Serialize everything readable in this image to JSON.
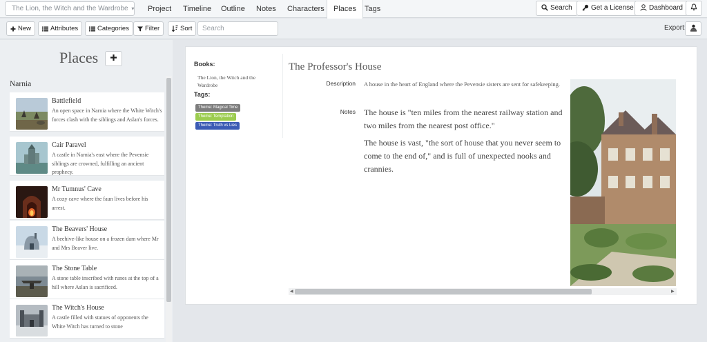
{
  "header": {
    "book_selector": "The Lion, the Witch and the Wardrobe",
    "nav": [
      "Project",
      "Timeline",
      "Outline",
      "Notes",
      "Characters",
      "Places",
      "Tags"
    ],
    "active_nav": "Places",
    "search_label": "Search",
    "license_label": "Get a License",
    "dashboard_label": "Dashboard"
  },
  "toolbar": {
    "new_label": "New",
    "attributes_label": "Attributes",
    "categories_label": "Categories",
    "filter_label": "Filter",
    "sort_label": "Sort",
    "search_placeholder": "Search",
    "export_label": "Export:"
  },
  "sidebar": {
    "title": "Places",
    "group": "Narnia",
    "items": [
      {
        "title": "Battlefield",
        "desc": "An open space in Narnia where the White Witch's forces clash with the siblings and Aslan's forces."
      },
      {
        "title": "Cair Paravel",
        "desc": "A castle in Narnia's east where the Pevensie siblings are crowned, fulfilling an ancient prophecy."
      },
      {
        "title": "Mr Tumnus' Cave",
        "desc": "A cozy cave where the faun lives before his arrest."
      },
      {
        "title": "The Beavers' House",
        "desc": "A beehive-like house on a frozen dam where Mr and Mrs Beaver live."
      },
      {
        "title": "The Stone Table",
        "desc": "A stone table inscribed with runes at the top of a hill where Aslan is sacrificed."
      },
      {
        "title": "The Witch's House",
        "desc": "A castle filled with statues of opponents the White Witch has turned to stone"
      }
    ]
  },
  "detail": {
    "books_label": "Books:",
    "books": [
      "The Lion, the Witch and the Wardrobe"
    ],
    "tags_label": "Tags:",
    "tags": [
      {
        "label": "Theme: Magical Time",
        "color": "#7d7d7d"
      },
      {
        "label": "Theme: Temptation",
        "color": "#9ccc4f"
      },
      {
        "label": "Theme: Truth vs Lies",
        "color": "#3b5bb5"
      }
    ],
    "title": "The Professor's House",
    "description_label": "Description",
    "description": "A house in the heart of England where the Pevensie sisters are sent for safekeeping.",
    "notes_label": "Notes",
    "notes": [
      "The house is \"ten miles from the nearest railway station and two miles from the nearest post office.\"",
      "The house is vast, \"the sort of house that you never seem to come to the end of,\" and is full of unexpected nooks and crannies."
    ]
  }
}
